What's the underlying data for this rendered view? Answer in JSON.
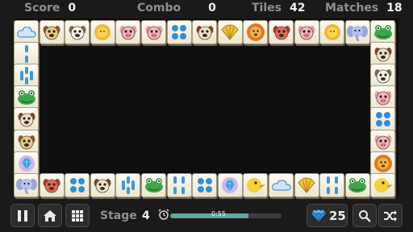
{
  "stats": {
    "score_label": "Score",
    "score_value": "0",
    "combo_label": "Combo",
    "combo_value": "0",
    "tiles_label": "Tiles",
    "tiles_value": "42",
    "matches_label": "Matches",
    "matches_value": "18"
  },
  "bottom_bar": {
    "stage_label": "Stage",
    "stage_value": "4",
    "timer_text": "0:55",
    "timer_progress": 0.7,
    "gems_count": "25"
  },
  "tiles": {
    "top_row": [
      "cloud",
      "dog-tan",
      "dog-white",
      "sun",
      "pig",
      "pig",
      "dots-4-blue",
      "dog-brown",
      "shell",
      "lion",
      "dog-red",
      "pig",
      "sun",
      "elephant",
      "frog"
    ],
    "left_column": [
      "bars-2",
      "bars-3",
      "frog",
      "dog-brown",
      "dog-tan",
      "blue-gem"
    ],
    "right_column": [
      "dog-brown",
      "dog-white",
      "pig",
      "dots-4-blue",
      "pig",
      "lion"
    ],
    "bottom_row": [
      "elephant",
      "dog-red",
      "dots-4-blue",
      "dog-brown",
      "bars-3",
      "frog",
      "bars-4",
      "dots-4-blue",
      "blue-gem",
      "duck",
      "cloud",
      "shell",
      "bars-4",
      "frog",
      "duck"
    ]
  },
  "colors": {
    "background": "#1a1a1a",
    "board": "#0f0f0f",
    "tile_face": "#f7f3e4",
    "accent_blue": "#2e8fd8",
    "timer_fill": "#5fa6a0"
  },
  "icons": {
    "pause": "pause-icon",
    "home": "home-icon",
    "menu": "grid-icon",
    "timer": "alarm-clock-icon",
    "gem": "diamond-icon",
    "hint": "magnifier-icon",
    "shuffle": "shuffle-icon"
  }
}
